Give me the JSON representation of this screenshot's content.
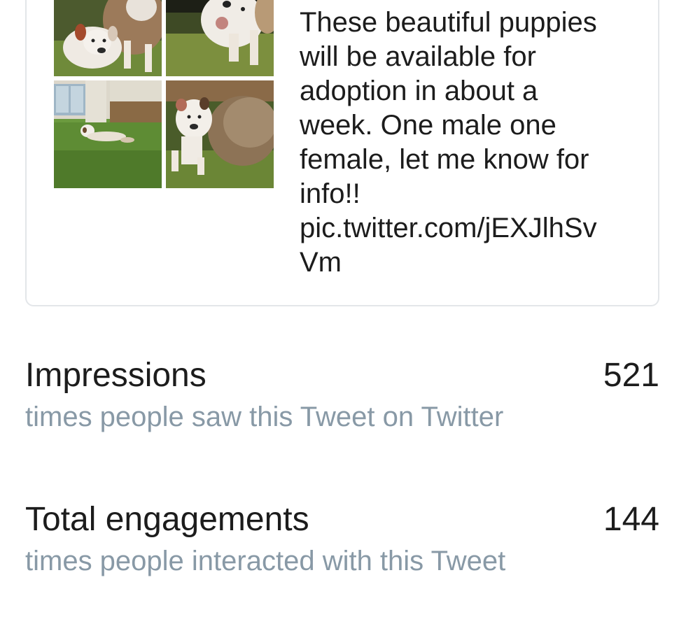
{
  "tweet": {
    "text_lines": [
      "These beautiful puppies",
      "will be available for",
      "adoption in about a",
      "week. One male one",
      "female, let me know for",
      "info!!",
      "pic.twitter.com/jEXJlhSv",
      "Vm"
    ],
    "photos": [
      {
        "name": "puppy-photo-1"
      },
      {
        "name": "puppy-photo-2"
      },
      {
        "name": "puppy-photo-3"
      },
      {
        "name": "puppy-photo-4"
      }
    ]
  },
  "metrics": {
    "impressions": {
      "label": "Impressions",
      "value": "521",
      "description": "times people saw this Tweet on Twitter"
    },
    "engagements": {
      "label": "Total engagements",
      "value": "144",
      "description": "times people interacted with this Tweet"
    }
  },
  "colors": {
    "primary_text": "#1c1c1c",
    "secondary_text": "#8899a6",
    "card_border": "#e3e6e9",
    "link": "#55acee"
  }
}
